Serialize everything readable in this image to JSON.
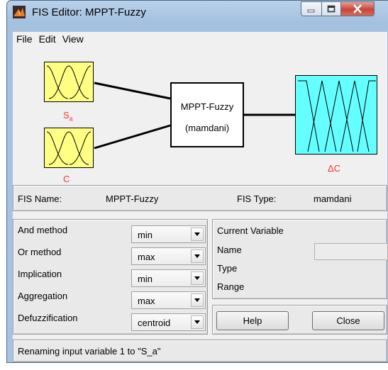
{
  "window": {
    "title": "FIS Editor: MPPT-Fuzzy",
    "icon": "matlab-icon"
  },
  "menu": [
    "File",
    "Edit",
    "View"
  ],
  "diagram": {
    "system_name": "MPPT-Fuzzy",
    "system_type": "(mamdani)",
    "inputs": [
      {
        "label": "S",
        "sub": "a"
      },
      {
        "label": "C",
        "sub": "..."
      }
    ],
    "output": {
      "label": "ΔC"
    }
  },
  "info": {
    "fis_name_label": "FIS Name:",
    "fis_name": "MPPT-Fuzzy",
    "fis_type_label": "FIS Type:",
    "fis_type": "mamdani"
  },
  "methods": [
    {
      "label": "And method",
      "value": "min"
    },
    {
      "label": "Or method",
      "value": "max"
    },
    {
      "label": "Implication",
      "value": "min"
    },
    {
      "label": "Aggregation",
      "value": "max"
    },
    {
      "label": "Defuzzification",
      "value": "centroid"
    }
  ],
  "current_variable": {
    "title": "Current Variable",
    "name_label": "Name",
    "type_label": "Type",
    "range_label": "Range",
    "name_value": ""
  },
  "buttons": {
    "help": "Help",
    "close": "Close"
  },
  "status": "Renaming input variable 1 to \"S_a\"",
  "colors": {
    "input_mf": "#ffff84",
    "output_mf": "#66ffff",
    "variable_label": "#ff3333"
  }
}
